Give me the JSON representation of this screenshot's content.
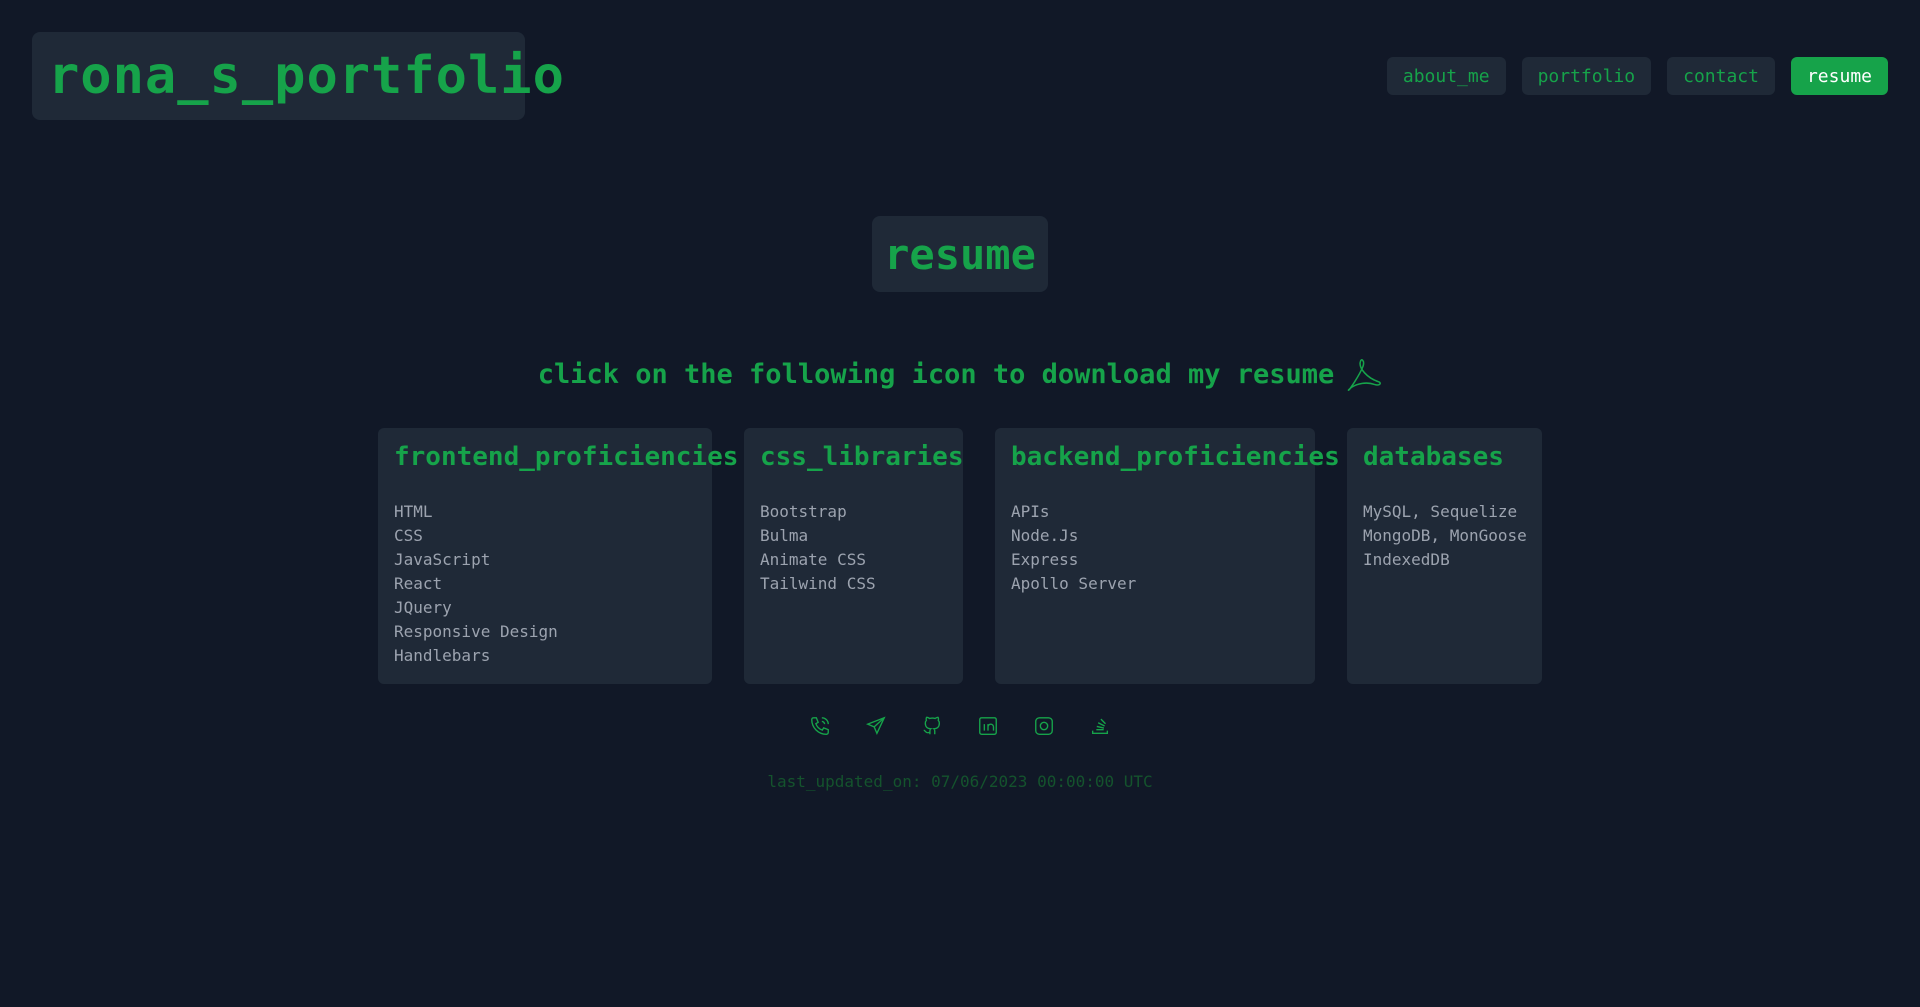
{
  "header": {
    "logo": "rona_s_portfolio",
    "nav": [
      {
        "label": "about_me",
        "active": false
      },
      {
        "label": "portfolio",
        "active": false
      },
      {
        "label": "contact",
        "active": false
      },
      {
        "label": "resume",
        "active": true
      }
    ]
  },
  "main": {
    "title": "resume",
    "download_text": "click on the following icon to download my resume",
    "download_icon": "pdf-icon",
    "cards": [
      {
        "title": "frontend_proficiencies",
        "items": [
          "HTML",
          "CSS",
          "JavaScript",
          "React",
          "JQuery",
          "Responsive Design",
          "Handlebars"
        ]
      },
      {
        "title": "css_libraries",
        "items": [
          "Bootstrap",
          "Bulma",
          "Animate CSS",
          "Tailwind CSS"
        ]
      },
      {
        "title": "backend_proficiencies",
        "items": [
          "APIs",
          "Node.Js",
          "Express",
          "Apollo Server"
        ]
      },
      {
        "title": "databases",
        "items": [
          "MySQL, Sequelize",
          "MongoDB, MonGoose",
          "IndexedDB"
        ]
      }
    ]
  },
  "footer": {
    "socials": [
      "phone-icon",
      "send-icon",
      "github-icon",
      "linkedin-icon",
      "instagram-icon",
      "stackoverflow-icon"
    ],
    "last_updated": "last_updated_on: 07/06/2023 00:00:00 UTC"
  },
  "colors": {
    "background": "#111827",
    "panel": "#1f2937",
    "accent": "#16a34a",
    "muted_text": "#9ca3af"
  }
}
